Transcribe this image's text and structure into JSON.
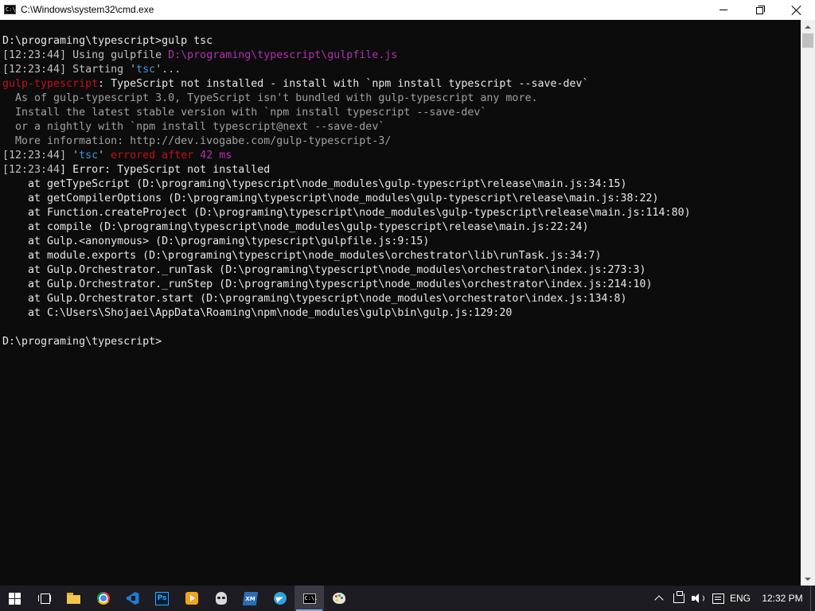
{
  "window": {
    "title": "C:\\Windows\\system32\\cmd.exe",
    "icon": "cmd-icon",
    "icon_text": "C:\\."
  },
  "console": {
    "lines": [
      [
        {
          "t": "D:\\programing\\typescript>gulp tsc",
          "c": "white"
        }
      ],
      [
        {
          "t": "[",
          "c": "grey"
        },
        {
          "t": "12:23:44",
          "c": "grey"
        },
        {
          "t": "] Using gulpfile ",
          "c": "grey"
        },
        {
          "t": "D:\\programing\\typescript\\gulpfile.js",
          "c": "magenta"
        }
      ],
      [
        {
          "t": "[",
          "c": "grey"
        },
        {
          "t": "12:23:44",
          "c": "grey"
        },
        {
          "t": "] Starting '",
          "c": "grey"
        },
        {
          "t": "tsc",
          "c": "cyan"
        },
        {
          "t": "'...",
          "c": "grey"
        }
      ],
      [
        {
          "t": "gulp-typescript",
          "c": "red"
        },
        {
          "t": ": TypeScript not installed - install with `npm install typescript --save-dev`",
          "c": "white"
        }
      ],
      [
        {
          "t": "  As of gulp-typescript 3.0, TypeScript isn't bundled with gulp-typescript any more.",
          "c": "dim"
        }
      ],
      [
        {
          "t": "  Install the latest stable version with `npm install typescript --save-dev`",
          "c": "dim"
        }
      ],
      [
        {
          "t": "  or a nightly with `npm install typescript@next --save-dev`",
          "c": "dim"
        }
      ],
      [
        {
          "t": "  More information: http://dev.ivogabe.com/gulp-typescript-3/",
          "c": "dim"
        }
      ],
      [
        {
          "t": "[",
          "c": "grey"
        },
        {
          "t": "12:23:44",
          "c": "grey"
        },
        {
          "t": "] '",
          "c": "grey"
        },
        {
          "t": "tsc",
          "c": "cyan"
        },
        {
          "t": "' ",
          "c": "grey"
        },
        {
          "t": "errored after ",
          "c": "red"
        },
        {
          "t": "42 ms",
          "c": "magenta"
        }
      ],
      [
        {
          "t": "[",
          "c": "grey"
        },
        {
          "t": "12:23:44",
          "c": "grey"
        },
        {
          "t": "] Error: TypeScript not installed",
          "c": "white"
        }
      ],
      [
        {
          "t": "    at getTypeScript (D:\\programing\\typescript\\node_modules\\gulp-typescript\\release\\main.js:34:15)",
          "c": "white"
        }
      ],
      [
        {
          "t": "    at getCompilerOptions (D:\\programing\\typescript\\node_modules\\gulp-typescript\\release\\main.js:38:22)",
          "c": "white"
        }
      ],
      [
        {
          "t": "    at Function.createProject (D:\\programing\\typescript\\node_modules\\gulp-typescript\\release\\main.js:114:80)",
          "c": "white"
        }
      ],
      [
        {
          "t": "    at compile (D:\\programing\\typescript\\node_modules\\gulp-typescript\\release\\main.js:22:24)",
          "c": "white"
        }
      ],
      [
        {
          "t": "    at Gulp.<anonymous> (D:\\programing\\typescript\\gulpfile.js:9:15)",
          "c": "white"
        }
      ],
      [
        {
          "t": "    at module.exports (D:\\programing\\typescript\\node_modules\\orchestrator\\lib\\runTask.js:34:7)",
          "c": "white"
        }
      ],
      [
        {
          "t": "    at Gulp.Orchestrator._runTask (D:\\programing\\typescript\\node_modules\\orchestrator\\index.js:273:3)",
          "c": "white"
        }
      ],
      [
        {
          "t": "    at Gulp.Orchestrator._runStep (D:\\programing\\typescript\\node_modules\\orchestrator\\index.js:214:10)",
          "c": "white"
        }
      ],
      [
        {
          "t": "    at Gulp.Orchestrator.start (D:\\programing\\typescript\\node_modules\\orchestrator\\index.js:134:8)",
          "c": "white"
        }
      ],
      [
        {
          "t": "    at C:\\Users\\Shojaei\\AppData\\Roaming\\npm\\node_modules\\gulp\\bin\\gulp.js:129:20",
          "c": "white"
        }
      ],
      [
        {
          "t": "",
          "c": "white"
        }
      ],
      [
        {
          "t": "D:\\programing\\typescript>",
          "c": "white"
        }
      ]
    ]
  },
  "colors": {
    "console_bg": "#0c0c0c",
    "red": "#c50f1f",
    "magenta": "#b030b0",
    "cyan": "#3a96dd"
  },
  "taskbar": {
    "items": [
      {
        "name": "start-button",
        "icon": "windows-logo-icon"
      },
      {
        "name": "task-view-button",
        "icon": "task-view-icon"
      },
      {
        "name": "file-explorer-button",
        "icon": "folder-icon"
      },
      {
        "name": "chrome-button",
        "icon": "chrome-icon"
      },
      {
        "name": "vscode-button",
        "icon": "vscode-icon"
      },
      {
        "name": "photoshop-button",
        "icon": "photoshop-icon",
        "label": "Ps"
      },
      {
        "name": "media-player-button",
        "icon": "media-icon"
      },
      {
        "name": "app-button",
        "icon": "alien-icon"
      },
      {
        "name": "xampp-button",
        "icon": "xampp-icon",
        "label": "XM"
      },
      {
        "name": "telegram-button",
        "icon": "telegram-icon"
      },
      {
        "name": "cmd-button",
        "icon": "cmd-icon",
        "active": true,
        "label": "C:\\."
      },
      {
        "name": "paint-button",
        "icon": "paint-icon"
      }
    ],
    "tray": {
      "language": "ENG",
      "time": "12:32 PM"
    }
  }
}
